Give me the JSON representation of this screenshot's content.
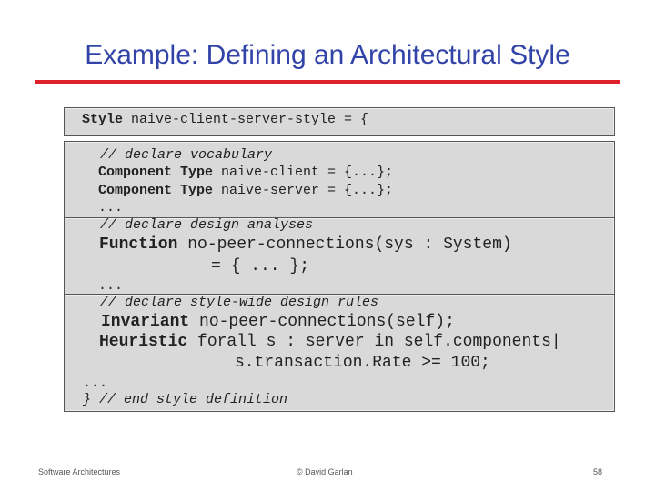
{
  "slide": {
    "title": "Example: Defining an Architectural Style",
    "code": {
      "l1_kw": "Style",
      "l1_rest": " naive-client-server-style = {",
      "l2": "// declare vocabulary",
      "l3_kw": "Component Type",
      "l3_rest": " naive-client = {...};",
      "l4_kw": "Component Type",
      "l4_rest": " naive-server = {...};",
      "l5": "...",
      "l6": "// declare design analyses",
      "l7_kw": "Function",
      "l7_rest": " no-peer-connections(sys : System)",
      "l8": "= { ... };",
      "l9": "...",
      "l10": "// declare style-wide design rules",
      "l11_kw": "Invariant",
      "l11_rest": " no-peer-connections(self);",
      "l12_kw": "Heuristic",
      "l12_rest": " forall s : server in self.components|",
      "l13": "s.transaction.Rate >= 100;",
      "l14": "...",
      "l15": "} // end style definition"
    },
    "footer": {
      "left": "Software Architectures",
      "center": "© David Garlan",
      "page": "58"
    },
    "colors": {
      "title": "#3344a8",
      "rule": "#e0202a",
      "box": "#d9d9d9"
    }
  }
}
